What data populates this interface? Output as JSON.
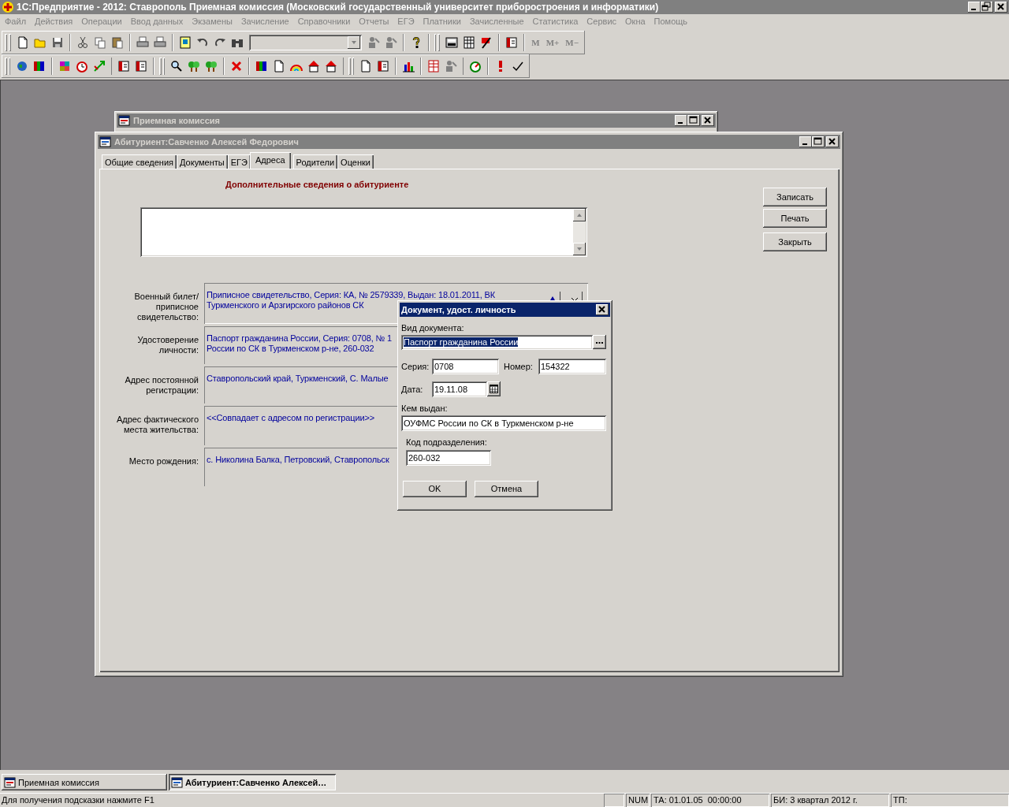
{
  "app": {
    "title": "1С:Предприятие - 2012: Ставрополь Приемная комиссия (Московский государственный университет приборостроения и информатики)",
    "active": false
  },
  "menu": [
    {
      "label": "Файл",
      "disabled": true
    },
    {
      "label": "Действия",
      "disabled": true
    },
    {
      "label": "Операции",
      "disabled": true
    },
    {
      "label": "Ввод данных",
      "disabled": true
    },
    {
      "label": "Экзамены",
      "disabled": true
    },
    {
      "label": "Зачисление",
      "disabled": true
    },
    {
      "label": "Справочники",
      "disabled": true
    },
    {
      "label": "Отчеты",
      "disabled": true
    },
    {
      "label": "ЕГЭ",
      "disabled": true
    },
    {
      "label": "Платники",
      "disabled": true
    },
    {
      "label": "Зачисленные",
      "disabled": true
    },
    {
      "label": "Статистика",
      "disabled": true
    },
    {
      "label": "Сервис",
      "disabled": true
    },
    {
      "label": "Окна",
      "disabled": true
    },
    {
      "label": "Помощь",
      "disabled": true
    }
  ],
  "toolbar": {
    "memory_buttons": [
      {
        "label": "M",
        "disabled": true
      },
      {
        "label": "M+",
        "disabled": true
      },
      {
        "label": "M−",
        "disabled": true
      }
    ]
  },
  "windows": [
    {
      "title": "Приемная комиссия",
      "active": false
    }
  ],
  "form": {
    "title": "Абитуриент:Савченко Алексей Федорович",
    "active": false,
    "tabs": [
      {
        "label": "Общие сведения",
        "selected": false
      },
      {
        "label": "Документы",
        "selected": false
      },
      {
        "label": "ЕГЭ",
        "selected": false
      },
      {
        "label": "Адреса",
        "selected": true
      },
      {
        "label": "Родители",
        "selected": false
      },
      {
        "label": "Оценки",
        "selected": false
      }
    ],
    "heading": "Дополнительные сведения о абитуриенте",
    "fields": [
      {
        "label": "Военный билет/\nприписное\nсвидетельство:",
        "value": "Приписное свидетельство, Серия: КА, № 2579339, Выдан: 18.01.2011, ВК\nТуркменского и Арзгирского районов СК"
      },
      {
        "label": "Удостоверение\nличности:",
        "value": "Паспорт гражданина России, Серия: 0708, № 1\nРоссии по СК в Туркменском р-не, 260-032"
      },
      {
        "label": "Адрес постоянной\nрегистрации:",
        "value": "Ставропольский край, Туркменский, С. Малые"
      },
      {
        "label": "Адрес фактического\nместа жительства:",
        "value": "<<Совпадает с адресом по регистрации>>"
      },
      {
        "label": "Место рождения:",
        "value": "с. Николина Балка, Петровский, Ставропольск"
      }
    ],
    "buttons": [
      "Записать",
      "Печать",
      "Закрыть"
    ]
  },
  "dialog": {
    "title": "Документ, удост. личность",
    "active": true,
    "doc_type": {
      "label": "Вид документа:",
      "value": "Паспорт гражданина России",
      "highlighted": true
    },
    "series": {
      "label": "Серия:",
      "value": "0708"
    },
    "number": {
      "label": "Номер:",
      "value": "154322"
    },
    "date": {
      "label": "Дата:",
      "value": "19.11.08"
    },
    "issued_by": {
      "label": "Кем выдан:",
      "value": "ОУФМС России по СК в Туркменском р-не"
    },
    "unit_code": {
      "label": "Код подразделения:",
      "value": "260-032"
    },
    "buttons": [
      "OK",
      "Отмена"
    ]
  },
  "taskbar": [
    {
      "label": "Приемная комиссия",
      "selected": false
    },
    {
      "label": "Абитуриент:Савченко Алексей…",
      "selected": true
    }
  ],
  "status_bar": {
    "hint": "Для получения подсказки нажмите F1",
    "panels": [
      "NUM",
      "ТА: 01.01.05  00:00:00",
      "БИ: 3 квартал 2012 г.",
      "ТП:"
    ]
  }
}
